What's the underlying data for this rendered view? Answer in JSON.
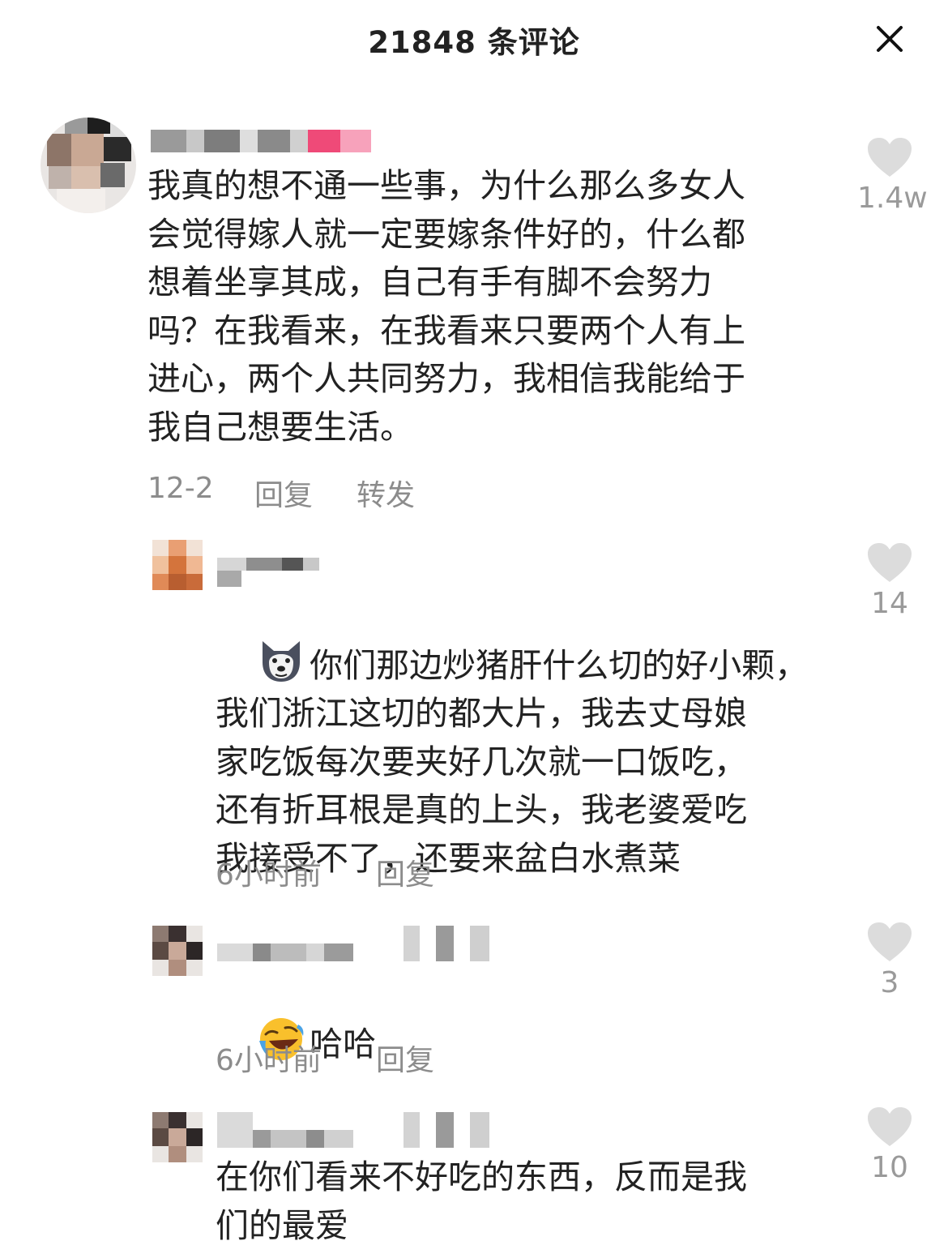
{
  "header": {
    "title": "21848 条评论",
    "close_icon": "close-icon"
  },
  "comments": [
    {
      "text": "我真的想不通一些事，为什么那么多女人\n会觉得嫁人就一定要嫁条件好的，什么都\n想着坐享其成，自己有手有脚不会努力\n吗？在我看来，在我看来只要两个人有上\n进心，两个人共同努力，我相信我能给于\n我自己想要生活。",
      "date": "12-2",
      "reply_label": "回复",
      "share_label": "转发",
      "likes": "1.4w"
    },
    {
      "emoji": "husky-emoji",
      "text": "你们那边炒猪肝什么切的好小颗，\n我们浙江这切的都大片，我去丈母娘\n家吃饭每次要夹好几次就一口饭吃，\n还有折耳根是真的上头，我老婆爱吃\n我接受不了，还要来盆白水煮菜",
      "date": "6小时前",
      "reply_label": "回复",
      "likes": "14"
    },
    {
      "emoji": "laughing-crying-emoji",
      "text": "哈哈",
      "date": "6小时前",
      "reply_label": "回复",
      "likes": "3"
    },
    {
      "text": "在你们看来不好吃的东西，反而是我\n们的最爱",
      "likes": "10"
    }
  ],
  "colors": {
    "like_heart": "#dcdcdc",
    "meta_text": "#8c8c8c",
    "body_text": "#222222"
  }
}
